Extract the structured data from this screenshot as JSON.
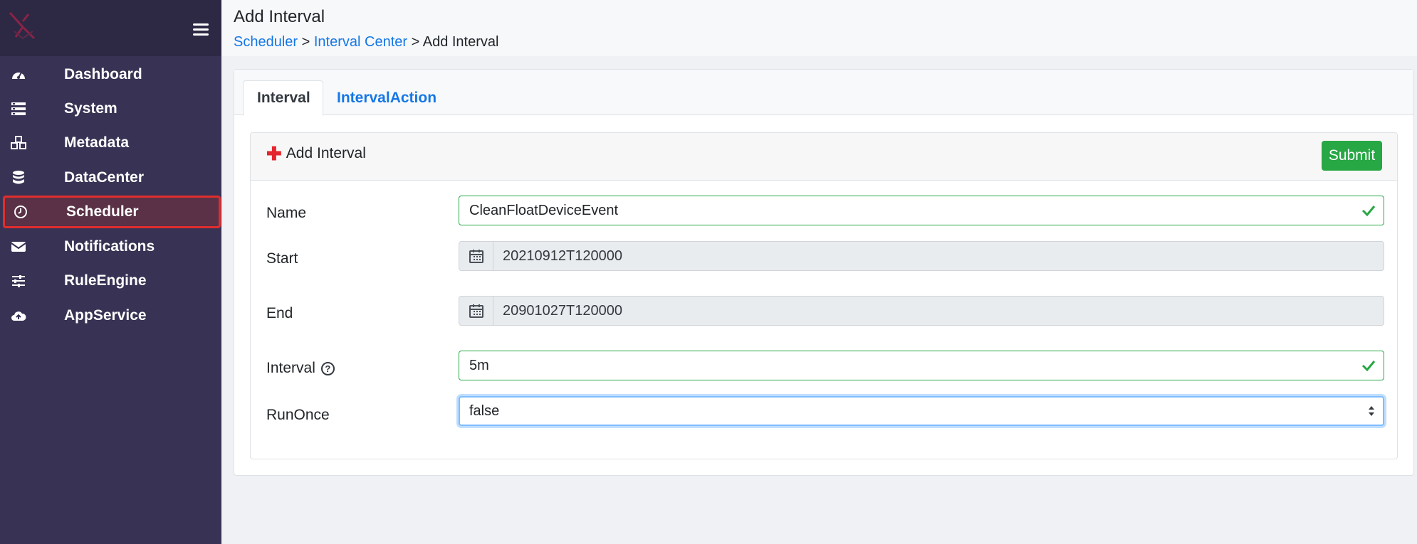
{
  "sidebar": {
    "items": [
      {
        "label": "Dashboard",
        "icon": "dashboard-icon"
      },
      {
        "label": "System",
        "icon": "server-icon"
      },
      {
        "label": "Metadata",
        "icon": "cubes-icon"
      },
      {
        "label": "DataCenter",
        "icon": "database-icon"
      },
      {
        "label": "Scheduler",
        "icon": "clock-icon",
        "active": true
      },
      {
        "label": "Notifications",
        "icon": "envelope-icon"
      },
      {
        "label": "RuleEngine",
        "icon": "sliders-icon"
      },
      {
        "label": "AppService",
        "icon": "cloud-upload-icon"
      }
    ]
  },
  "header": {
    "title": "Add Interval",
    "breadcrumb": {
      "scheduler": "Scheduler",
      "sep1": " > ",
      "interval_center": "Interval Center",
      "sep2": " > ",
      "current": "Add Interval"
    }
  },
  "tabs": [
    {
      "label": "Interval",
      "active": true
    },
    {
      "label": "IntervalAction",
      "active": false
    }
  ],
  "form": {
    "title": "Add Interval",
    "submit_label": "Submit",
    "name": {
      "label": "Name",
      "value": "CleanFloatDeviceEvent"
    },
    "start": {
      "label": "Start",
      "value": "20210912T120000"
    },
    "end": {
      "label": "End",
      "value": "20901027T120000"
    },
    "interval": {
      "label": "Interval",
      "value": "5m"
    },
    "runonce": {
      "label": "RunOnce",
      "value": "false"
    }
  },
  "colors": {
    "sidebar_bg": "#383354",
    "active_border": "#e02d2d",
    "link": "#1577e6",
    "success": "#28a745",
    "plus": "#e3262d"
  }
}
